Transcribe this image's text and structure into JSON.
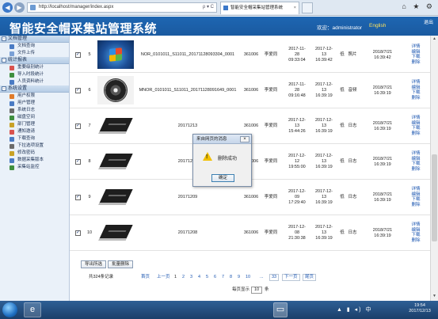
{
  "browser": {
    "url": "http://localhost/manager/index.aspx",
    "address_tools": "ρ ▾ C",
    "tab_title": "智能安全帽采集站管理系统",
    "tab_close": "×",
    "nav_back": "◀",
    "nav_fwd": "▶",
    "toolbar_icons": "⌂ ★ ⚙"
  },
  "header": {
    "title": "智能安全帽采集站管理系统",
    "welcome": "欢迎：administrator",
    "language": "English",
    "logout": "退出"
  },
  "sidebar": {
    "sections": [
      {
        "title": "文档管理",
        "items": [
          {
            "label": "文档查询",
            "icon": "doc-search-icon",
            "color": "#4a7bc4"
          },
          {
            "label": "文件上传",
            "icon": "upload-icon",
            "color": "#7aa0d6"
          }
        ]
      },
      {
        "title": "统计报表",
        "items": [
          {
            "label": "重要级别统计",
            "icon": "chart-icon",
            "color": "#d9534f"
          },
          {
            "label": "导入时段统计",
            "icon": "chart-icon",
            "color": "#3f8f3f"
          },
          {
            "label": "人员资料统计",
            "icon": "people-icon",
            "color": "#4a7bc4"
          }
        ]
      },
      {
        "title": "系统设置",
        "items": [
          {
            "label": "用户权限",
            "icon": "user-icon",
            "color": "#e07b2a"
          },
          {
            "label": "用户管理",
            "icon": "users-icon",
            "color": "#4a7bc4"
          },
          {
            "label": "系统日志",
            "icon": "log-icon",
            "color": "#6b6b6b"
          },
          {
            "label": "磁盘空间",
            "icon": "disk-icon",
            "color": "#3f8f3f"
          },
          {
            "label": "部门管理",
            "icon": "dept-icon",
            "color": "#c9a227"
          },
          {
            "label": "通知邀请",
            "icon": "notice-icon",
            "color": "#d9534f"
          },
          {
            "label": "下载查询",
            "icon": "download-icon",
            "color": "#4a7bc4"
          },
          {
            "label": "下拉选项设置",
            "icon": "settings-icon",
            "color": "#6b6b6b"
          },
          {
            "label": "修改密码",
            "icon": "key-icon",
            "color": "#c9a227"
          },
          {
            "label": "数据采集版本",
            "icon": "version-icon",
            "color": "#4a7bc4"
          },
          {
            "label": "采集站监控",
            "icon": "monitor-icon",
            "color": "#3f8f3f"
          }
        ]
      }
    ]
  },
  "rows": [
    {
      "no": "5",
      "checked": "✓",
      "name": "NOR_0101011_S11011_20171128093304_0001",
      "station": "361006",
      "person": "李爱同",
      "time1": [
        "2017-11-",
        "28",
        "09:33:04"
      ],
      "time2": [
        "2017-12-",
        "13",
        "16:39:42"
      ],
      "level": "低",
      "type": "照片",
      "date": [
        "2018/7/21",
        "16:39:42"
      ],
      "thumb": "windows"
    },
    {
      "no": "6",
      "checked": "✓",
      "name": "MNOR_0101011_S11011_20171128091649_0001",
      "station": "361006",
      "person": "李爱同",
      "time1": [
        "2017-11-",
        "28",
        "09:16:48"
      ],
      "time2": [
        "2017-12-",
        "13",
        "16:39:19"
      ],
      "level": "低",
      "type": "音频",
      "date": [
        "2018/7/21",
        "16:39:19"
      ],
      "thumb": "speaker"
    },
    {
      "no": "7",
      "checked": "✓",
      "name": "20171213",
      "station": "361006",
      "person": "李爱同",
      "time1": [
        "2017-12-",
        "13",
        "15:44:26"
      ],
      "time2": [
        "2017-12-",
        "13",
        "16:39:19"
      ],
      "level": "低",
      "type": "日志",
      "date": [
        "2018/7/21",
        "16:39:19"
      ],
      "thumb": "notebook"
    },
    {
      "no": "8",
      "checked": "✓",
      "name": "20171212",
      "station": "361006",
      "person": "李爱同",
      "time1": [
        "2017-12-",
        "12",
        "19:55:00"
      ],
      "time2": [
        "2017-12-",
        "13",
        "16:39:19"
      ],
      "level": "低",
      "type": "日志",
      "date": [
        "2018/7/21",
        "16:39:19"
      ],
      "thumb": "notebook"
    },
    {
      "no": "9",
      "checked": "✓",
      "name": "20171209",
      "station": "361006",
      "person": "李爱同",
      "time1": [
        "2017-12-",
        "09",
        "17:29:40"
      ],
      "time2": [
        "2017-12-",
        "13",
        "16:39:19"
      ],
      "level": "低",
      "type": "日志",
      "date": [
        "2018/7/21",
        "16:39:19"
      ],
      "thumb": "notebook"
    },
    {
      "no": "10",
      "checked": "✓",
      "name": "20171208",
      "station": "361006",
      "person": "李爱同",
      "time1": [
        "2017-12-",
        "08",
        "21:30:38"
      ],
      "time2": [
        "2017-12-",
        "13",
        "16:39:19"
      ],
      "level": "低",
      "type": "日志",
      "date": [
        "2018/7/21",
        "16:39:19"
      ],
      "thumb": "notebook"
    }
  ],
  "row_actions": [
    "详情",
    "编辑",
    "下载",
    "删除"
  ],
  "toolbar": {
    "export_label": "导出所选",
    "batch_delete_label": "批量删除"
  },
  "pager": {
    "total": "共324条记录",
    "first": "首页",
    "prev": "上一页",
    "pages": [
      "1",
      "2",
      "3",
      "4",
      "5",
      "6",
      "7",
      "8",
      "9",
      "10",
      "...",
      "33"
    ],
    "next": "下一页",
    "last": "尾页",
    "per_page_prefix": "每页显示",
    "per_page_value": "10",
    "per_page_suffix": "条"
  },
  "dialog": {
    "title": "来自网页的消息",
    "close": "×",
    "message": "删除成功",
    "ok_label": "确定",
    "warn_mark": "!"
  },
  "taskbar": {
    "time": "19:54",
    "date": "2017/12/13",
    "tray_icons": "▲ ▮ ◂) 中"
  }
}
